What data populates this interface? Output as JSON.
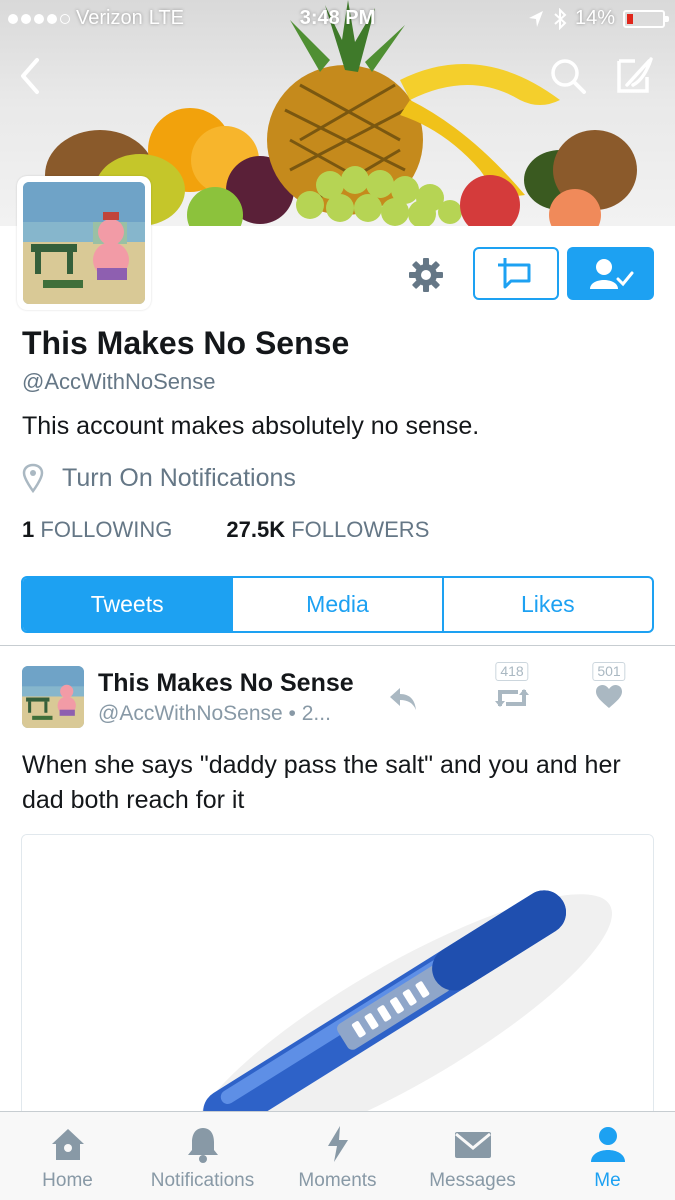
{
  "status_bar": {
    "carrier": "Verizon",
    "network": "LTE",
    "time": "3:48 PM",
    "battery": "14%"
  },
  "colors": {
    "accent": "#1da1f2",
    "text_primary": "#14171a",
    "text_secondary": "#657786",
    "battery_low": "#e0261b"
  },
  "nav": {
    "back_icon": "chevron-left-icon",
    "search_icon": "search-icon",
    "compose_icon": "compose-icon"
  },
  "profile": {
    "name": "This Makes No Sense",
    "handle": "@AccWithNoSense",
    "bio": "This account makes absolutely no sense.",
    "notifications_label": "Turn On Notifications",
    "following_count": "1",
    "following_label": "FOLLOWING",
    "followers_count": "27.5K",
    "followers_label": "FOLLOWERS"
  },
  "tabs": [
    {
      "label": "Tweets",
      "active": true
    },
    {
      "label": "Media",
      "active": false
    },
    {
      "label": "Likes",
      "active": false
    }
  ],
  "tweet": {
    "name": "This Makes No Sense",
    "handle_time": "@AccWithNoSense • 2...",
    "text": "When she says \"daddy pass the salt\" and you and her dad both reach for it",
    "retweets": "418",
    "likes": "501"
  },
  "tabbar": [
    {
      "label": "Home",
      "icon": "home-icon",
      "active": false
    },
    {
      "label": "Notifications",
      "icon": "bell-icon",
      "active": false
    },
    {
      "label": "Moments",
      "icon": "lightning-icon",
      "active": false
    },
    {
      "label": "Messages",
      "icon": "envelope-icon",
      "active": false
    },
    {
      "label": "Me",
      "icon": "person-icon",
      "active": true
    }
  ]
}
